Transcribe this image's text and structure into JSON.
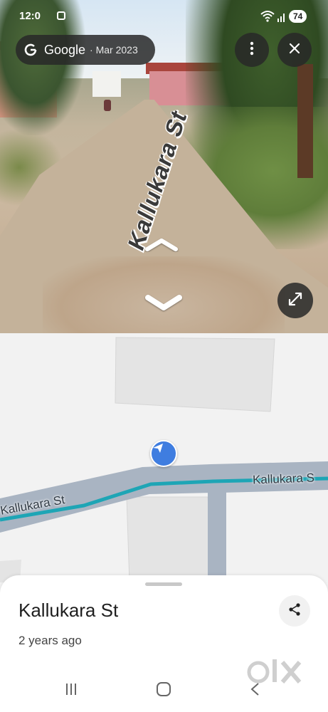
{
  "status_bar": {
    "time": "12:0",
    "battery": "74"
  },
  "street_view": {
    "brand": "Google",
    "capture_date": "· Mar 2023",
    "street_overlay_label": "Kallukara St",
    "icons": [
      "google-g-icon",
      "more-vert-icon",
      "close-icon",
      "chevron-up-icon",
      "chevron-down-icon",
      "expand-icon"
    ]
  },
  "map": {
    "road_label_right": "Kallukara S",
    "road_label_left": "Kallukara St",
    "marker_icon": "navigation-arrow-icon",
    "road_color": "#a9b4c2",
    "route_color": "#1ea5b5",
    "marker_color": "#3f7de0"
  },
  "place_sheet": {
    "title": "Kallukara St",
    "subtitle": "2 years ago",
    "share_icon": "share-icon"
  },
  "watermark": {
    "text": "OLX"
  },
  "nav_bar": {
    "icons": [
      "recents-icon",
      "home-icon",
      "back-icon"
    ]
  }
}
